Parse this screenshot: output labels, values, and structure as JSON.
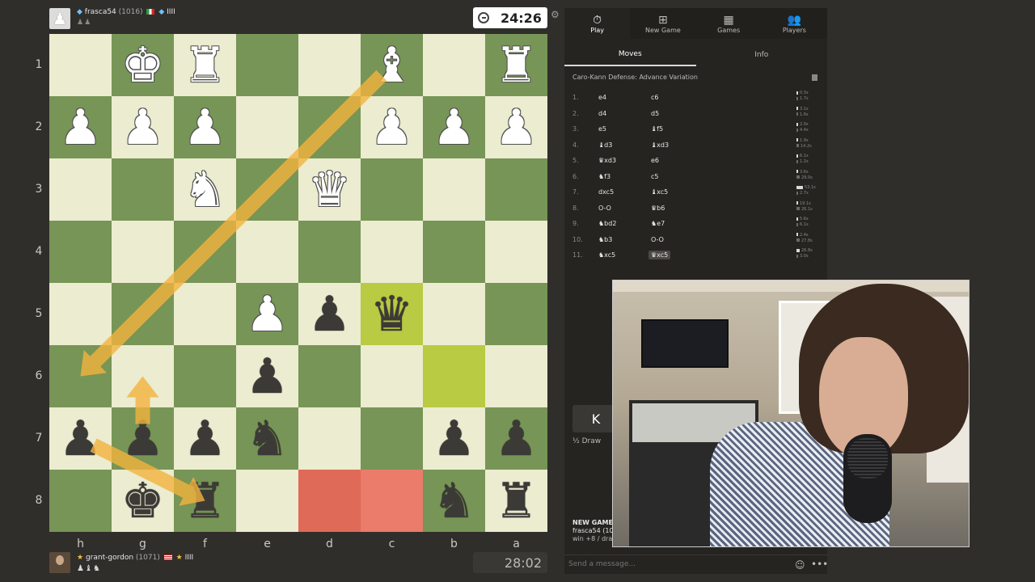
{
  "top_player": {
    "name": "frasca54",
    "rating": "(1016)",
    "badges": "IIII",
    "captured": "♟♟",
    "clock": "24:26"
  },
  "bottom_player": {
    "name": "grant-gordon",
    "rating": "(1071)",
    "badges": "IIII",
    "captured": "♟♝♞",
    "clock": "28:02"
  },
  "board": {
    "orientation": "black",
    "rank_labels": [
      "1",
      "2",
      "3",
      "4",
      "5",
      "6",
      "7",
      "8"
    ],
    "file_labels": [
      "h",
      "g",
      "f",
      "e",
      "d",
      "c",
      "b",
      "a"
    ],
    "pieces": [
      {
        "sq": "g1",
        "p": "♚",
        "c": "w"
      },
      {
        "sq": "f1",
        "p": "♜",
        "c": "w"
      },
      {
        "sq": "c1",
        "p": "♝",
        "c": "w"
      },
      {
        "sq": "a1",
        "p": "♜",
        "c": "w"
      },
      {
        "sq": "h2",
        "p": "♟",
        "c": "w"
      },
      {
        "sq": "g2",
        "p": "♟",
        "c": "w"
      },
      {
        "sq": "f2",
        "p": "♟",
        "c": "w"
      },
      {
        "sq": "c2",
        "p": "♟",
        "c": "w"
      },
      {
        "sq": "b2",
        "p": "♟",
        "c": "w"
      },
      {
        "sq": "a2",
        "p": "♟",
        "c": "w"
      },
      {
        "sq": "f3",
        "p": "♞",
        "c": "w"
      },
      {
        "sq": "d3",
        "p": "♛",
        "c": "w"
      },
      {
        "sq": "e5",
        "p": "♟",
        "c": "w"
      },
      {
        "sq": "d5",
        "p": "♟",
        "c": "b"
      },
      {
        "sq": "c5",
        "p": "♛",
        "c": "b"
      },
      {
        "sq": "e6",
        "p": "♟",
        "c": "b"
      },
      {
        "sq": "h7",
        "p": "♟",
        "c": "b"
      },
      {
        "sq": "g7",
        "p": "♟",
        "c": "b"
      },
      {
        "sq": "f7",
        "p": "♟",
        "c": "b"
      },
      {
        "sq": "e7",
        "p": "♞",
        "c": "b"
      },
      {
        "sq": "b7",
        "p": "♟",
        "c": "b"
      },
      {
        "sq": "a7",
        "p": "♟",
        "c": "b"
      },
      {
        "sq": "g8",
        "p": "♚",
        "c": "b"
      },
      {
        "sq": "f8",
        "p": "♜",
        "c": "b"
      },
      {
        "sq": "b8",
        "p": "♞",
        "c": "b"
      },
      {
        "sq": "a8",
        "p": "♜",
        "c": "b"
      }
    ],
    "highlights": [
      {
        "sq": "c5",
        "type": "last-move"
      },
      {
        "sq": "b6",
        "type": "last-move"
      },
      {
        "sq": "d8",
        "type": "red"
      },
      {
        "sq": "c8",
        "type": "red"
      }
    ],
    "arrows": [
      {
        "from": "c1",
        "to": "h6",
        "color": "#f2b33d"
      },
      {
        "from": "h7",
        "to": "f8",
        "color": "#f2b33d"
      },
      {
        "from": "g7",
        "to": "g6",
        "color": "#f2b33d"
      }
    ],
    "colors": {
      "light": "#ebecd0",
      "dark": "#779556"
    }
  },
  "nav": [
    {
      "label": "Play",
      "icon": "stopwatch-icon",
      "glyph": "⏱"
    },
    {
      "label": "New Game",
      "icon": "plus-icon",
      "glyph": "⊞"
    },
    {
      "label": "Games",
      "icon": "board-icon",
      "glyph": "▦"
    },
    {
      "label": "Players",
      "icon": "players-icon",
      "glyph": "👥"
    }
  ],
  "subtabs": [
    "Moves",
    "Info"
  ],
  "opening": "Caro-Kann Defense: Advance Variation",
  "moves": [
    {
      "n": "1.",
      "w": "e4",
      "b": "c6",
      "tw": "0.3s",
      "tb": "1.7s",
      "bw": 2,
      "bb": 2
    },
    {
      "n": "2.",
      "w": "d4",
      "b": "d5",
      "tw": "3.1s",
      "tb": "1.6s",
      "bw": 2,
      "bb": 2
    },
    {
      "n": "3.",
      "w": "e5",
      "b": "♝f5",
      "tw": "2.0s",
      "tb": "4.4s",
      "bw": 2,
      "bb": 2
    },
    {
      "n": "4.",
      "w": "♝d3",
      "b": "♝xd3",
      "tw": "1.9s",
      "tb": "14.2s",
      "bw": 2,
      "bb": 3
    },
    {
      "n": "5.",
      "w": "♛xd3",
      "b": "e6",
      "tw": "6.1s",
      "tb": "1.2s",
      "bw": 2,
      "bb": 2
    },
    {
      "n": "6.",
      "w": "♞f3",
      "b": "c5",
      "tw": "3.6s",
      "tb": "29.0s",
      "bw": 2,
      "bb": 4
    },
    {
      "n": "7.",
      "w": "dxc5",
      "b": "♝xc5",
      "tw": "53.1s",
      "tb": "2.7s",
      "bw": 8,
      "bb": 2
    },
    {
      "n": "8.",
      "w": "O-O",
      "b": "♛b6",
      "tw": "19.1s",
      "tb": "26.1s",
      "bw": 2,
      "bb": 4
    },
    {
      "n": "9.",
      "w": "♞bd2",
      "b": "♞e7",
      "tw": "5.6s",
      "tb": "6.1s",
      "bw": 2,
      "bb": 2
    },
    {
      "n": "10.",
      "w": "♞b3",
      "b": "O-O",
      "tw": "2.4s",
      "tb": "27.8s",
      "bw": 2,
      "bb": 4
    },
    {
      "n": "11.",
      "w": "♞xc5",
      "b": "♛xc5",
      "tw": "26.8s",
      "tb": "3.0s",
      "bw": 4,
      "bb": 2
    }
  ],
  "controls": {
    "back_glyph": "K",
    "draw_label": "½ Draw"
  },
  "new_game": {
    "title": "NEW GAME",
    "line1": "frasca54 (10",
    "line2": "win +8 / draw"
  },
  "chat": {
    "placeholder": "Send a message..."
  }
}
